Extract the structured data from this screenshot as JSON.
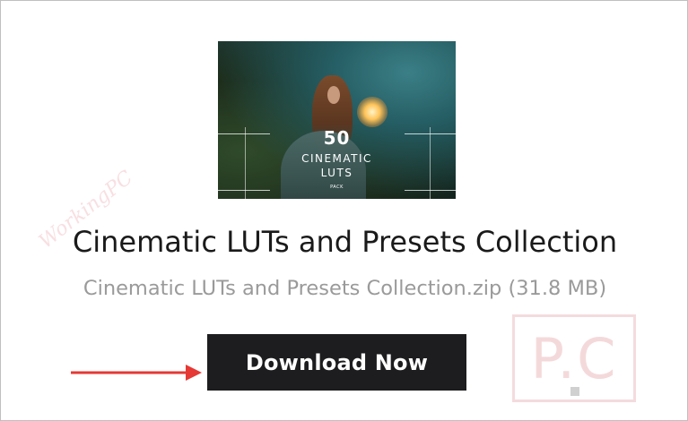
{
  "thumbnail": {
    "line1": "50",
    "line2": "CINEMATIC",
    "line3": "LUTS",
    "line4": "PACK"
  },
  "title": "Cinematic LUTs and Presets Collection",
  "file_info": "Cinematic LUTs and Presets Collection.zip (31.8 MB)",
  "download_button": "Download Now",
  "watermark": {
    "text": "WorkingPC",
    "logo": "P.C"
  },
  "colors": {
    "button_bg": "#1d1d1f",
    "arrow": "#e53935",
    "subtitle_text": "#9a9a9a"
  }
}
